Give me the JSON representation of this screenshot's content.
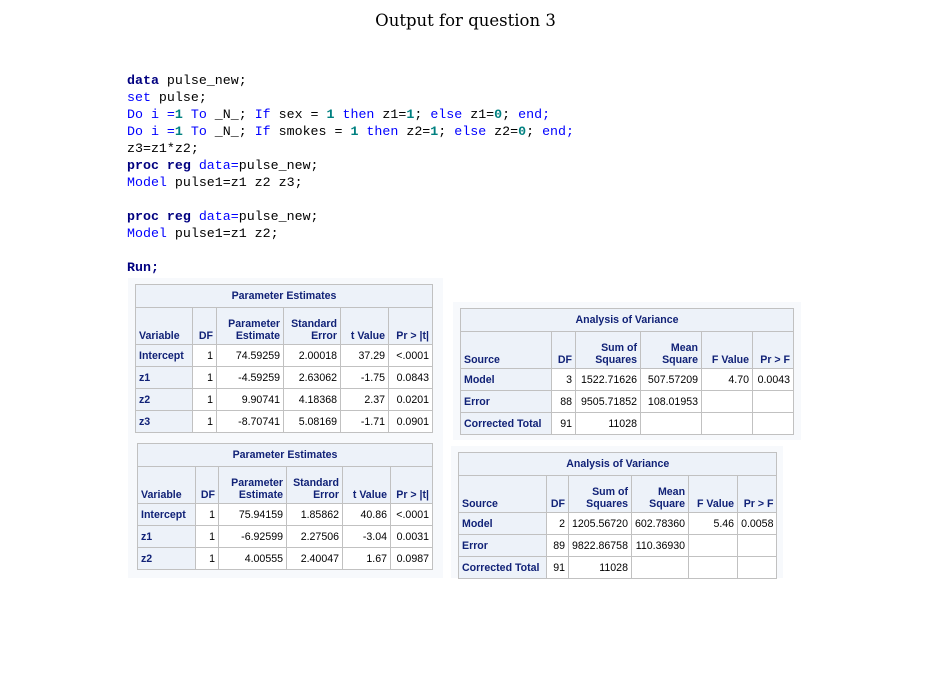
{
  "page_title": "Output for question 3",
  "code_lines": [
    [
      {
        "t": "data",
        "c": "kw"
      },
      {
        "t": " pulse_new;",
        "c": "txt"
      }
    ],
    [
      {
        "t": "set",
        "c": "kw2"
      },
      {
        "t": " pulse;",
        "c": "txt"
      }
    ],
    [
      {
        "t": "Do i =",
        "c": "kw2"
      },
      {
        "t": "1",
        "c": "num"
      },
      {
        "t": " To ",
        "c": "kw2"
      },
      {
        "t": "_N_;",
        "c": "txt"
      },
      {
        "t": " If ",
        "c": "kw2"
      },
      {
        "t": "sex = ",
        "c": "txt"
      },
      {
        "t": "1",
        "c": "num"
      },
      {
        "t": " then ",
        "c": "kw2"
      },
      {
        "t": "z1=",
        "c": "txt"
      },
      {
        "t": "1",
        "c": "num"
      },
      {
        "t": "; ",
        "c": "txt"
      },
      {
        "t": "else ",
        "c": "kw2"
      },
      {
        "t": "z1=",
        "c": "txt"
      },
      {
        "t": "0",
        "c": "num"
      },
      {
        "t": "; ",
        "c": "txt"
      },
      {
        "t": "end;",
        "c": "kw2"
      }
    ],
    [
      {
        "t": "Do i =",
        "c": "kw2"
      },
      {
        "t": "1",
        "c": "num"
      },
      {
        "t": " To ",
        "c": "kw2"
      },
      {
        "t": "_N_;",
        "c": "txt"
      },
      {
        "t": " If ",
        "c": "kw2"
      },
      {
        "t": "smokes = ",
        "c": "txt"
      },
      {
        "t": "1",
        "c": "num"
      },
      {
        "t": " then ",
        "c": "kw2"
      },
      {
        "t": "z2=",
        "c": "txt"
      },
      {
        "t": "1",
        "c": "num"
      },
      {
        "t": "; ",
        "c": "txt"
      },
      {
        "t": "else ",
        "c": "kw2"
      },
      {
        "t": "z2=",
        "c": "txt"
      },
      {
        "t": "0",
        "c": "num"
      },
      {
        "t": "; ",
        "c": "txt"
      },
      {
        "t": "end;",
        "c": "kw2"
      }
    ],
    [
      {
        "t": "z3=z1*z2;",
        "c": "txt"
      }
    ],
    [
      {
        "t": "proc reg",
        "c": "kw"
      },
      {
        "t": " data=",
        "c": "kw2"
      },
      {
        "t": "pulse_new;",
        "c": "txt"
      }
    ],
    [
      {
        "t": "Model",
        "c": "kw2"
      },
      {
        "t": " pulse1=z1 z2 z3;",
        "c": "txt"
      }
    ],
    [],
    [
      {
        "t": "proc reg",
        "c": "kw"
      },
      {
        "t": " data=",
        "c": "kw2"
      },
      {
        "t": "pulse_new;",
        "c": "txt"
      }
    ],
    [
      {
        "t": "Model",
        "c": "kw2"
      },
      {
        "t": " pulse1=z1 z2;",
        "c": "txt"
      }
    ],
    [],
    [
      {
        "t": "Run;",
        "c": "kw"
      }
    ]
  ],
  "tables": {
    "pe1": {
      "caption": "Parameter Estimates",
      "headers": [
        "Variable",
        "DF",
        "Parameter\nEstimate",
        "Standard\nError",
        "t Value",
        "Pr > |t|"
      ],
      "rows": [
        [
          "Intercept",
          "1",
          "74.59259",
          "2.00018",
          "37.29",
          "<.0001"
        ],
        [
          "z1",
          "1",
          "-4.59259",
          "2.63062",
          "-1.75",
          "0.0843"
        ],
        [
          "z2",
          "1",
          "9.90741",
          "4.18368",
          "2.37",
          "0.0201"
        ],
        [
          "z3",
          "1",
          "-8.70741",
          "5.08169",
          "-1.71",
          "0.0901"
        ]
      ]
    },
    "anova1": {
      "caption": "Analysis of Variance",
      "headers": [
        "Source",
        "DF",
        "Sum of\nSquares",
        "Mean\nSquare",
        "F Value",
        "Pr > F"
      ],
      "rows": [
        [
          "Model",
          "3",
          "1522.71626",
          "507.57209",
          "4.70",
          "0.0043"
        ],
        [
          "Error",
          "88",
          "9505.71852",
          "108.01953",
          "",
          ""
        ],
        [
          "Corrected Total",
          "91",
          "11028",
          "",
          "",
          ""
        ]
      ]
    },
    "pe2": {
      "caption": "Parameter Estimates",
      "headers": [
        "Variable",
        "DF",
        "Parameter\nEstimate",
        "Standard\nError",
        "t Value",
        "Pr > |t|"
      ],
      "rows": [
        [
          "Intercept",
          "1",
          "75.94159",
          "1.85862",
          "40.86",
          "<.0001"
        ],
        [
          "z1",
          "1",
          "-6.92599",
          "2.27506",
          "-3.04",
          "0.0031"
        ],
        [
          "z2",
          "1",
          "4.00555",
          "2.40047",
          "1.67",
          "0.0987"
        ]
      ]
    },
    "anova2": {
      "caption": "Analysis of Variance",
      "headers": [
        "Source",
        "DF",
        "Sum of\nSquares",
        "Mean\nSquare",
        "F Value",
        "Pr > F"
      ],
      "rows": [
        [
          "Model",
          "2",
          "1205.56720",
          "602.78360",
          "5.46",
          "0.0058"
        ],
        [
          "Error",
          "89",
          "9822.86758",
          "110.36930",
          "",
          ""
        ],
        [
          "Corrected Total",
          "91",
          "11028",
          "",
          "",
          ""
        ]
      ]
    }
  }
}
